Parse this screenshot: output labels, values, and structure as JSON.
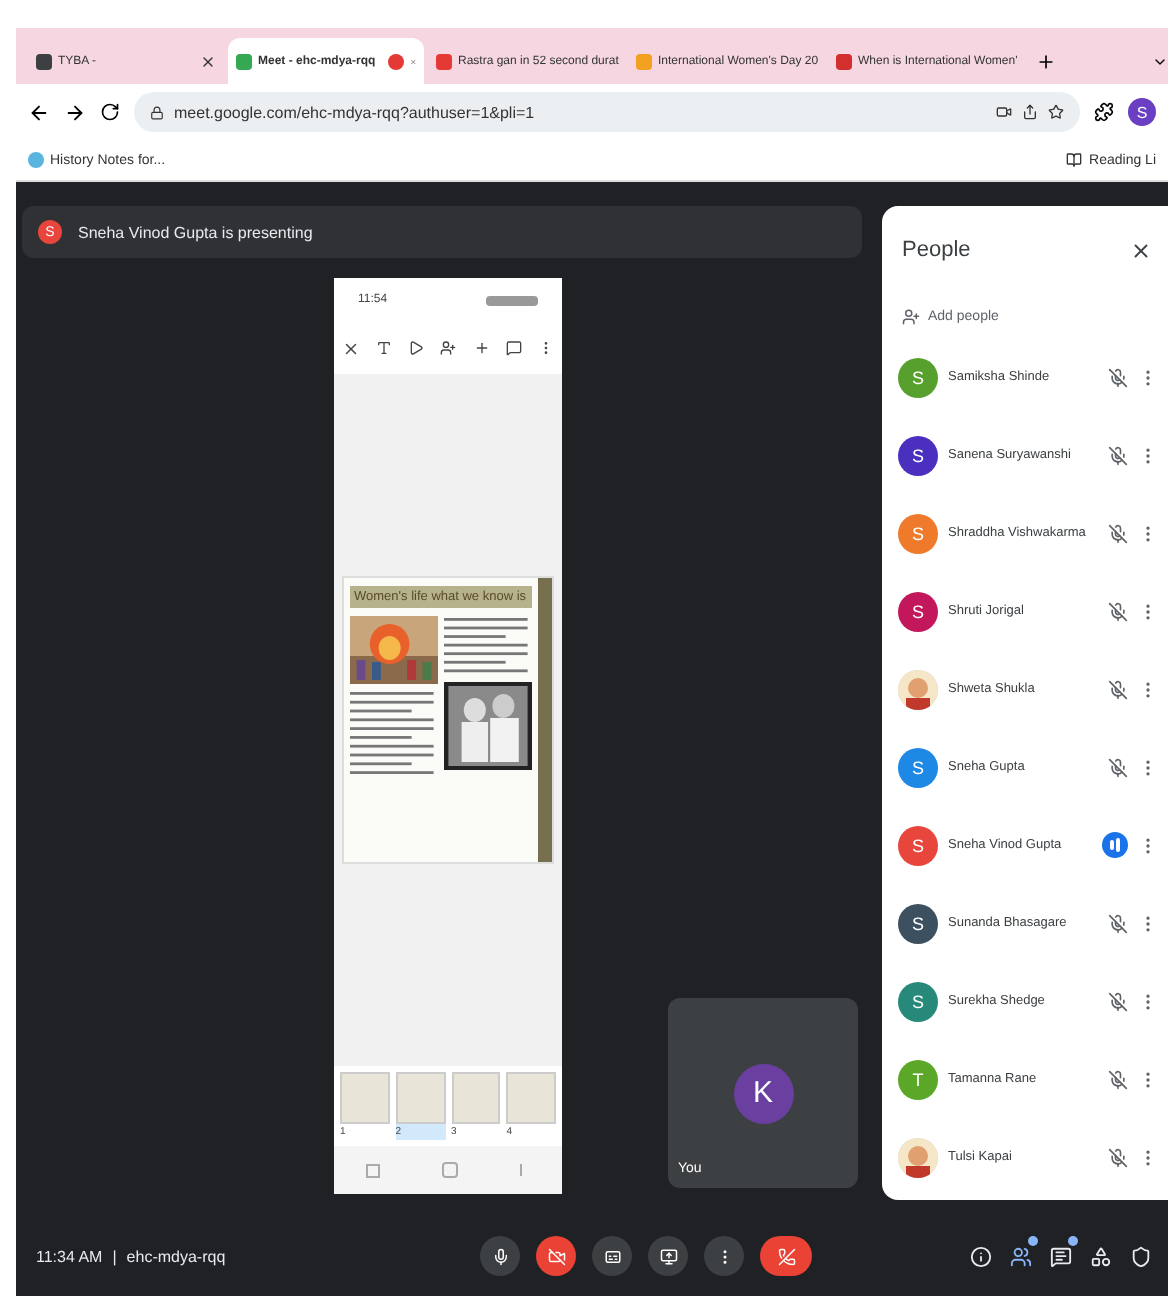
{
  "browser": {
    "tabs": [
      {
        "title": "TYBA -",
        "selected": false,
        "color": "#3c4043"
      },
      {
        "title": "Meet - ehc-mdya-rqq",
        "selected": true,
        "color": "#34a853",
        "recording": true
      },
      {
        "title": "Rastra gan in 52 second durat",
        "selected": false,
        "color": "#e53935"
      },
      {
        "title": "International Women's Day 20",
        "selected": false,
        "color": "#f4a020"
      },
      {
        "title": "When is International Women'",
        "selected": false,
        "color": "#d32f2f"
      }
    ],
    "address": "meet.google.com/ehc-mdya-rqq?authuser=1&pli=1",
    "profile_initial": "S",
    "bookmarks": [
      {
        "label": "History Notes for..."
      }
    ],
    "reading_list": "Reading Li"
  },
  "meet": {
    "presenting_banner": {
      "initial": "S",
      "text": "Sneha Vinod Gupta is presenting"
    },
    "phone": {
      "time": "11:54",
      "slide_title": "Women's life what we know is",
      "thumbnails": [
        {
          "number": "1",
          "selected": false
        },
        {
          "number": "2",
          "selected": true
        },
        {
          "number": "3",
          "selected": false
        },
        {
          "number": "4",
          "selected": false
        }
      ]
    },
    "self_tile": {
      "initial": "K",
      "label": "You"
    },
    "people_panel": {
      "title": "People",
      "add_label": "Add people",
      "people": [
        {
          "name": "Samiksha Shinde",
          "initial": "S",
          "color": "#58a02e",
          "muted": true
        },
        {
          "name": "Sanena Suryawanshi",
          "initial": "S",
          "color": "#4b2fbf",
          "muted": true
        },
        {
          "name": "Shraddha Vishwakarma",
          "initial": "S",
          "color": "#f07a2c",
          "muted": true
        },
        {
          "name": "Shruti Jorigal",
          "initial": "S",
          "color": "#c2185b",
          "muted": true
        },
        {
          "name": "Shweta Shukla",
          "kind": "picture",
          "muted": true
        },
        {
          "name": "Sneha Gupta",
          "initial": "S",
          "color": "#1e88e5",
          "muted": true
        },
        {
          "name": "Sneha Vinod Gupta",
          "initial": "S",
          "color": "#e8453c",
          "muted": false
        },
        {
          "name": "Sunanda Bhasagare",
          "initial": "S",
          "color": "#3d5060",
          "muted": true
        },
        {
          "name": "Surekha Shedge",
          "initial": "S",
          "color": "#26897a",
          "muted": true
        },
        {
          "name": "Tamanna Rane",
          "initial": "T",
          "color": "#5ba829",
          "muted": true
        },
        {
          "name": "Tulsi Kapai",
          "kind": "picture",
          "muted": true
        }
      ]
    },
    "bottom_bar": {
      "time": "11:34 AM",
      "separator": "|",
      "meeting_code": "ehc-mdya-rqq",
      "controls": [
        {
          "kind": "mic",
          "on": true
        },
        {
          "kind": "camera",
          "on": false
        },
        {
          "kind": "captions"
        },
        {
          "kind": "present"
        },
        {
          "kind": "more"
        },
        {
          "kind": "end"
        }
      ],
      "side_buttons": [
        {
          "kind": "info"
        },
        {
          "kind": "people",
          "badge": true
        },
        {
          "kind": "chat",
          "badge": true
        },
        {
          "kind": "activities"
        },
        {
          "kind": "safety"
        }
      ]
    }
  }
}
